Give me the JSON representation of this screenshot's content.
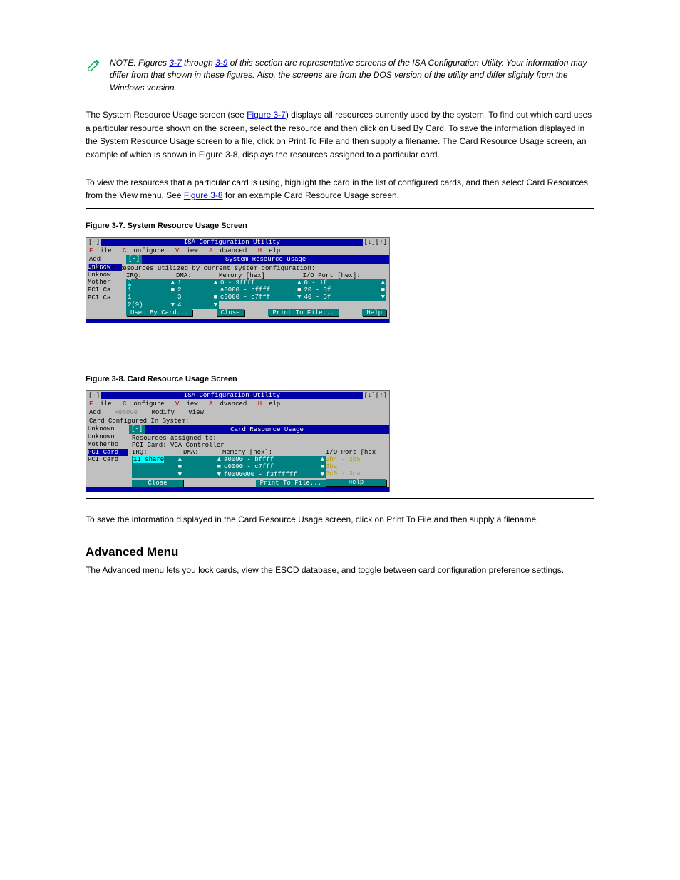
{
  "note": {
    "text_prefix": "NOTE: Figures ",
    "link1": "3-7",
    "mid1": " through ",
    "link2": "3-9",
    "text_rest": " of this section are representative screens of the ISA Configuration Utility. Your information may differ from that shown in these figures. Also, the screens are from the DOS version of the utility and differ slightly from the Windows version."
  },
  "para1": {
    "prefix": "The System Resource Usage screen (see ",
    "link": "Figure 3-7",
    "rest": ") displays all resources currently used by the system. To find out which card uses a particular resource shown on the screen, select the resource and then click on Used By Card. To save the information displayed in the System Resource Usage screen to a file, click on Print To File and then supply a filename. The Card Resource Usage screen, an example of which is shown in Figure 3-8, displays the resources assigned to a particular card."
  },
  "para2": {
    "prefix": "To view the resources that a particular card is using, highlight the card in the list of configured cards, and then select Card Resources from the View menu. See ",
    "link": "Figure 3-8",
    "rest": " for an example Card Resource Usage screen."
  },
  "caption1": "Figure 3-7. System Resource Usage Screen",
  "caption2": "Figure 3-8. Card Resource Usage Screen",
  "para3": "To save the information displayed in the Card Resource Usage screen, click on Print To File and then supply a filename.",
  "h_advanced": "Advanced Menu",
  "para4": "The Advanced menu lets you lock cards, view the ESCD database, and toggle between card configuration preference settings.",
  "shot1": {
    "title": "ISA Configuration Utility",
    "ctrl_l": "[-]",
    "ctrl_r": "[↓][↑]",
    "menu": [
      "File",
      "Configure",
      "View",
      "Advanced",
      "Help"
    ],
    "sub_add": "Add",
    "blue": "System Resource Usage",
    "msg": "Card C  Resources utilized by current system configuration:",
    "side": [
      "Unknow",
      "Unknow",
      "Mother",
      "PCI Ca",
      "PCI Ca"
    ],
    "col_irq_hdr": "IRQ:",
    "col_irq": [
      "0",
      "1",
      "1",
      "2(9)"
    ],
    "col_dma_hdr": "DMA:",
    "col_dma": [
      "1",
      "2",
      "3",
      "4"
    ],
    "col_mem_hdr": "Memory [hex]:",
    "col_mem": [
      "0 - 9ffff",
      "a0000 - bffff",
      "c0000 - c7fff"
    ],
    "col_io_hdr": "I/O Port [hex]:",
    "col_io": [
      "0 - 1f",
      "20 - 3f",
      "40 - 5f"
    ],
    "btn_used": "Used By Card...",
    "btn_close": "Close",
    "btn_print": "Print To File...",
    "btn_help": "Help"
  },
  "shot2": {
    "title": "ISA Configuration Utility",
    "ctrl_l": "[-]",
    "ctrl_r": "[↓][↑]",
    "menu": [
      "File",
      "Configure",
      "View",
      "Advanced",
      "Help"
    ],
    "sub_add": "Add",
    "sub_remove": "Remove",
    "sub_modify": "Modify",
    "sub_view": "View",
    "hdr": "Card Configured In System:",
    "blue": "Card Resource Usage",
    "line_res": "Resources assigned to:",
    "line_card": "PCI Card: VGA Controller",
    "side": [
      "Unknown",
      "Unknown",
      "Motherbo",
      "PCI Card",
      "PCI Card"
    ],
    "col_irq_hdr": "IRQ:",
    "col_irq_val": "11 share",
    "col_dma_hdr": "DMA:",
    "col_mem_hdr": "Memory [hex]:",
    "col_mem": [
      "a0000 - bffff",
      "c0000 - c7fff",
      "f0000000 - f3ffffff"
    ],
    "col_io_hdr": "I/O Port [hex",
    "col_io": [
      "3b4 - 3b5",
      "3ba",
      "3c0 - 3ca"
    ],
    "btn_close": "Close",
    "btn_print": "Print To File...",
    "btn_help": "Help"
  }
}
